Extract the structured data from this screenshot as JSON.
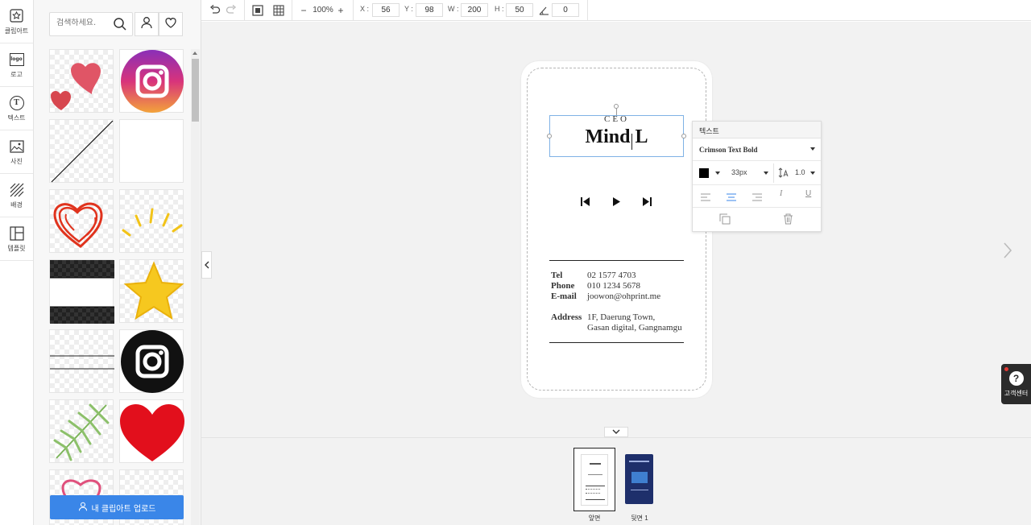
{
  "sidebar": {
    "items": [
      {
        "label": "클립아트",
        "icon": "clipart-star-icon"
      },
      {
        "label": "로고",
        "icon": "logo-icon",
        "icon_text": "logo"
      },
      {
        "label": "텍스트",
        "icon": "text-icon",
        "icon_text": "T"
      },
      {
        "label": "사진",
        "icon": "photo-icon"
      },
      {
        "label": "배경",
        "icon": "background-icon"
      },
      {
        "label": "템플릿",
        "icon": "template-icon"
      }
    ]
  },
  "panel": {
    "search_placeholder": "검색하세요.",
    "upload_label": "내 클립아트 업로드",
    "clipart_items": [
      "hearts",
      "instagram-gradient",
      "diagonal-line",
      "blank",
      "red-scribble-heart",
      "yellow-rays",
      "black-white-bars",
      "yellow-star",
      "horizontal-lines",
      "instagram-black",
      "green-leaf",
      "red-heart",
      "pink-heart-outline",
      "blank"
    ]
  },
  "toolbar": {
    "zoom_minus": "−",
    "zoom_value": "100%",
    "zoom_plus": "+",
    "x_label": "X :",
    "x_value": "56",
    "y_label": "Y :",
    "y_value": "98",
    "w_label": "W :",
    "w_value": "200",
    "h_label": "H :",
    "h_value": "50",
    "rotation_value": "0"
  },
  "card": {
    "title": "CEO",
    "name": "Mind L",
    "contacts": [
      {
        "label": "Tel",
        "value": "02 1577 4703"
      },
      {
        "label": "Phone",
        "value": "010 1234 5678"
      },
      {
        "label": "E-mail",
        "value": "joowon@ohprint.me"
      }
    ],
    "address_label": "Address",
    "address_line1": "1F, Daerung Town,",
    "address_line2": "Gasan digital, Gangnamgu"
  },
  "text_popup": {
    "title": "텍스트",
    "font": "Crimson Text Bold",
    "color": "#000000",
    "size": "33px",
    "line_height": "1.0"
  },
  "pages": {
    "front_label": "앞면",
    "back_label": "뒷면 1"
  },
  "help": {
    "label": "고객센터",
    "glyph": "?"
  },
  "colors": {
    "accent": "#3a86e8",
    "selection": "#7fb2e5"
  }
}
